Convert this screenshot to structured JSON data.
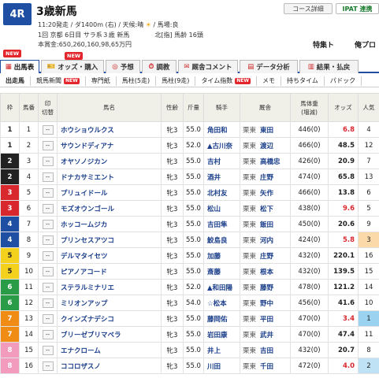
{
  "header": {
    "race_no": "4R",
    "title": "3歳新馬",
    "course_label": "コース詳細",
    "ipat_label": "IPAT 連携",
    "info1_a": "11:20発走 / ダ1400m (右) / 天候:晴",
    "info1_b": "/ 馬場:良",
    "info2": "1回 京都 6日目 サラ系３歳 新馬　　　　北[指] 馬齢 16頭",
    "info3": "本賞金:650,260,160,98,65万円",
    "tokushu": "特集ト",
    "yoso": "俺プロ"
  },
  "tabs": [
    {
      "label": "出馬表",
      "icon": "table-icon"
    },
    {
      "label": "オッズ・購入",
      "icon": "ticket-icon"
    },
    {
      "label": "予想",
      "icon": "target-icon"
    },
    {
      "label": "調教",
      "icon": "stopwatch-icon"
    },
    {
      "label": "厩舎コメント",
      "icon": "comment-icon"
    },
    {
      "label": "データ分析",
      "icon": "chart-icon"
    },
    {
      "label": "結果・払戻",
      "icon": "result-icon"
    }
  ],
  "new_label": "NEW",
  "subtabs": [
    "出走馬",
    "競馬新聞",
    "専門紙",
    "馬柱(5走)",
    "馬柱(9走)",
    "タイム指数",
    "メモ",
    "持ちタイム",
    "パドック"
  ],
  "columns": {
    "waku": "枠",
    "umaban": "馬番",
    "mark": "印",
    "mark_sub": "切替",
    "name": "馬名",
    "sex_age": "性齢",
    "weight_load": "斤量",
    "jockey": "騎手",
    "trainer": "厩舎",
    "body_weight": "馬体重",
    "body_weight_sub": "(増減)",
    "odds": "オッズ",
    "popularity": "人気"
  },
  "rows": [
    {
      "waku": "1",
      "umaban": "1",
      "mark": "--",
      "name": "ホウショウルクス",
      "sex_age": "牝3",
      "load": "55.0",
      "jockey": "角田和",
      "region": "栗東",
      "trainer": "東田",
      "body_weight": "446(0)",
      "odds": "6.8",
      "pop": "4"
    },
    {
      "waku": "1",
      "umaban": "2",
      "mark": "--",
      "name": "サウンドディアナ",
      "sex_age": "牝3",
      "load": "52.0",
      "jockey": "▲古川奈",
      "region": "栗東",
      "trainer": "渡辺",
      "body_weight": "466(0)",
      "odds": "48.5",
      "pop": "12"
    },
    {
      "waku": "2",
      "umaban": "3",
      "mark": "--",
      "name": "オヤソノジカン",
      "sex_age": "牝3",
      "load": "55.0",
      "jockey": "吉村",
      "region": "栗東",
      "trainer": "高橋忠",
      "body_weight": "426(0)",
      "odds": "20.9",
      "pop": "7"
    },
    {
      "waku": "2",
      "umaban": "4",
      "mark": "--",
      "name": "ドナカサミエント",
      "sex_age": "牝3",
      "load": "55.0",
      "jockey": "酒井",
      "region": "栗東",
      "trainer": "庄野",
      "body_weight": "474(0)",
      "odds": "65.8",
      "pop": "13"
    },
    {
      "waku": "3",
      "umaban": "5",
      "mark": "--",
      "name": "プリュイドール",
      "sex_age": "牝3",
      "load": "55.0",
      "jockey": "北村友",
      "region": "栗東",
      "trainer": "矢作",
      "body_weight": "466(0)",
      "odds": "13.8",
      "pop": "6"
    },
    {
      "waku": "3",
      "umaban": "6",
      "mark": "--",
      "name": "モズオウンゴール",
      "sex_age": "牝3",
      "load": "55.0",
      "jockey": "松山",
      "region": "栗東",
      "trainer": "松下",
      "body_weight": "438(0)",
      "odds": "9.6",
      "pop": "5"
    },
    {
      "waku": "4",
      "umaban": "7",
      "mark": "--",
      "name": "ホッコームジカ",
      "sex_age": "牝3",
      "load": "55.0",
      "jockey": "吉田隼",
      "region": "栗東",
      "trainer": "飯田",
      "body_weight": "450(0)",
      "odds": "20.6",
      "pop": "9"
    },
    {
      "waku": "4",
      "umaban": "8",
      "mark": "--",
      "name": "プリンセスアツコ",
      "sex_age": "牝3",
      "load": "55.0",
      "jockey": "鮫島良",
      "region": "栗東",
      "trainer": "河内",
      "body_weight": "424(0)",
      "odds": "5.8",
      "pop": "3"
    },
    {
      "waku": "5",
      "umaban": "9",
      "mark": "--",
      "name": "デルマタイセツ",
      "sex_age": "牝3",
      "load": "55.0",
      "jockey": "加藤",
      "region": "栗東",
      "trainer": "庄野",
      "body_weight": "432(0)",
      "odds": "220.1",
      "pop": "16"
    },
    {
      "waku": "5",
      "umaban": "10",
      "mark": "--",
      "name": "ピアノアコード",
      "sex_age": "牝3",
      "load": "55.0",
      "jockey": "斎藤",
      "region": "栗東",
      "trainer": "根本",
      "body_weight": "432(0)",
      "odds": "139.5",
      "pop": "15"
    },
    {
      "waku": "6",
      "umaban": "11",
      "mark": "--",
      "name": "ステラルミナリエ",
      "sex_age": "牝3",
      "load": "52.0",
      "jockey": "▲和田陽",
      "region": "栗東",
      "trainer": "藤野",
      "body_weight": "478(0)",
      "odds": "121.2",
      "pop": "14"
    },
    {
      "waku": "6",
      "umaban": "12",
      "mark": "--",
      "name": "ミリオンアップ",
      "sex_age": "牝3",
      "load": "54.0",
      "jockey": "☆松本",
      "region": "栗東",
      "trainer": "野中",
      "body_weight": "456(0)",
      "odds": "41.6",
      "pop": "10"
    },
    {
      "waku": "7",
      "umaban": "13",
      "mark": "--",
      "name": "クインズナデシコ",
      "sex_age": "牝3",
      "load": "55.0",
      "jockey": "藤岡佑",
      "region": "栗東",
      "trainer": "平田",
      "body_weight": "470(0)",
      "odds": "3.4",
      "pop": "1"
    },
    {
      "waku": "7",
      "umaban": "14",
      "mark": "--",
      "name": "ブリーゼブリマベラ",
      "sex_age": "牝3",
      "load": "55.0",
      "jockey": "岩田康",
      "region": "栗東",
      "trainer": "武井",
      "body_weight": "470(0)",
      "odds": "47.4",
      "pop": "11"
    },
    {
      "waku": "8",
      "umaban": "15",
      "mark": "--",
      "name": "エナクローム",
      "sex_age": "牝3",
      "load": "55.0",
      "jockey": "井上",
      "region": "栗東",
      "trainer": "吉田",
      "body_weight": "432(0)",
      "odds": "20.7",
      "pop": "8"
    },
    {
      "waku": "8",
      "umaban": "16",
      "mark": "--",
      "name": "ココロザスノ",
      "sex_age": "牝3",
      "load": "55.0",
      "jockey": "川田",
      "region": "栗東",
      "trainer": "千田",
      "body_weight": "472(0)",
      "odds": "4.0",
      "pop": "2"
    }
  ]
}
